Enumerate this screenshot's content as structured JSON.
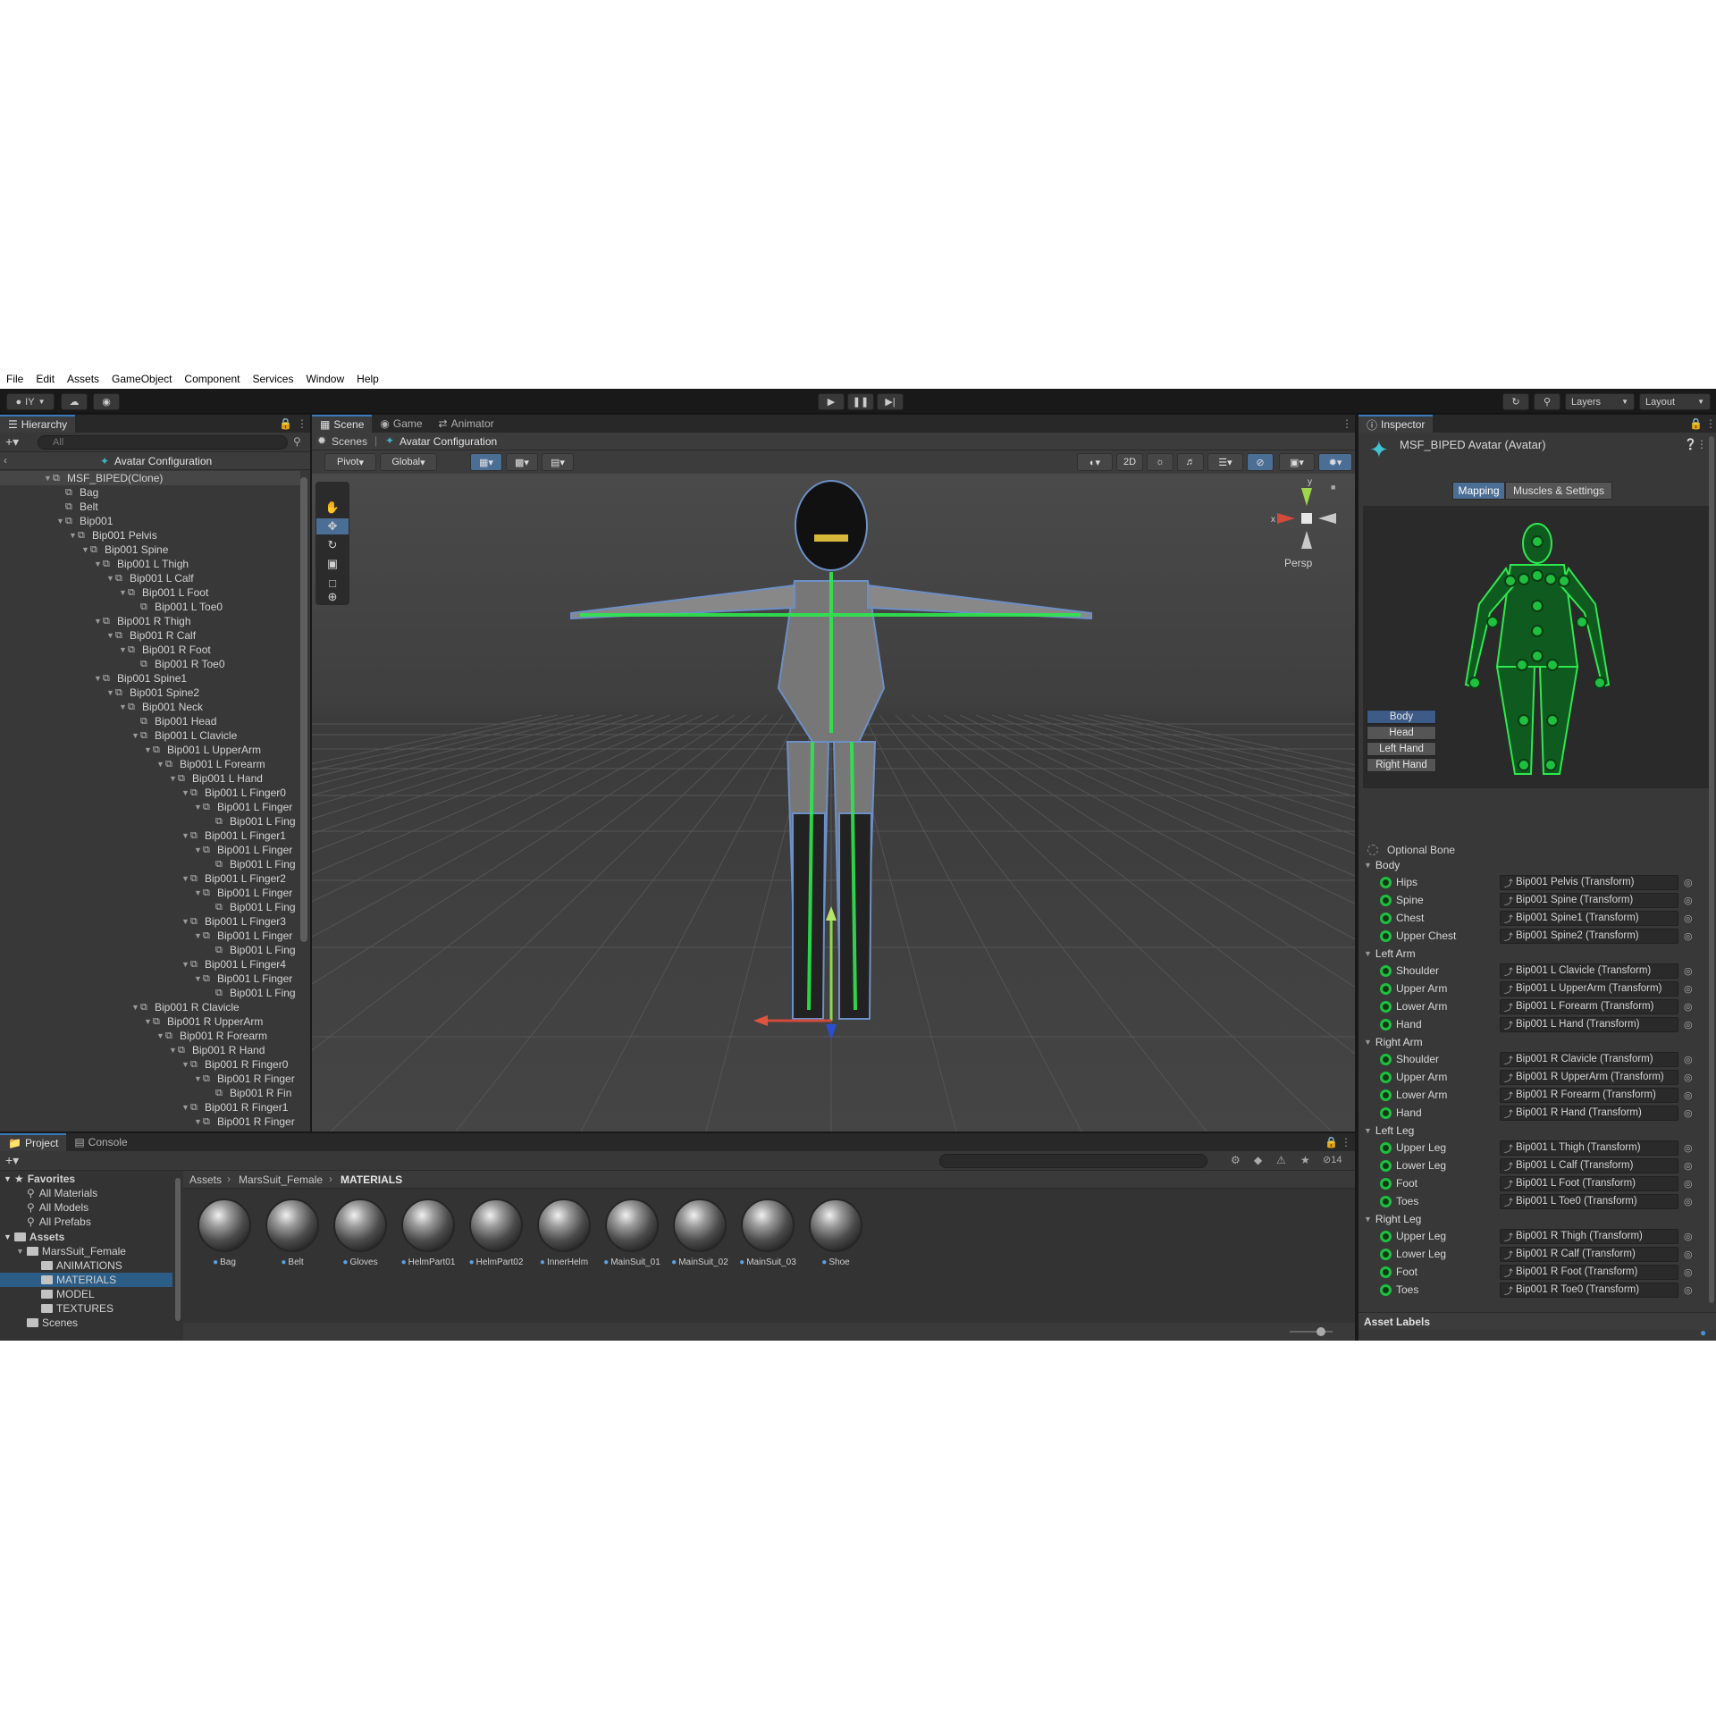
{
  "menu": [
    "File",
    "Edit",
    "Assets",
    "GameObject",
    "Component",
    "Services",
    "Window",
    "Help"
  ],
  "toolbar": {
    "account": "IY",
    "layers": "Layers",
    "layout": "Layout"
  },
  "hierarchy": {
    "tab": "Hierarchy",
    "search_placeholder": "All",
    "scene_title": "Avatar Configuration",
    "rows": [
      {
        "label": "MSF_BIPED(Clone)",
        "depth": 0,
        "expanded": true
      },
      {
        "label": "Bag",
        "depth": 1,
        "expanded": null
      },
      {
        "label": "Belt",
        "depth": 1,
        "expanded": null
      },
      {
        "label": "Bip001",
        "depth": 1,
        "expanded": true
      },
      {
        "label": "Bip001 Pelvis",
        "depth": 2,
        "expanded": true
      },
      {
        "label": "Bip001 Spine",
        "depth": 3,
        "expanded": true
      },
      {
        "label": "Bip001 L Thigh",
        "depth": 4,
        "expanded": true
      },
      {
        "label": "Bip001 L Calf",
        "depth": 5,
        "expanded": true
      },
      {
        "label": "Bip001 L Foot",
        "depth": 6,
        "expanded": true
      },
      {
        "label": "Bip001 L Toe0",
        "depth": 7,
        "expanded": null
      },
      {
        "label": "Bip001 R Thigh",
        "depth": 4,
        "expanded": true
      },
      {
        "label": "Bip001 R Calf",
        "depth": 5,
        "expanded": true
      },
      {
        "label": "Bip001 R Foot",
        "depth": 6,
        "expanded": true
      },
      {
        "label": "Bip001 R Toe0",
        "depth": 7,
        "expanded": null
      },
      {
        "label": "Bip001 Spine1",
        "depth": 4,
        "expanded": true
      },
      {
        "label": "Bip001 Spine2",
        "depth": 5,
        "expanded": true
      },
      {
        "label": "Bip001 Neck",
        "depth": 6,
        "expanded": true
      },
      {
        "label": "Bip001 Head",
        "depth": 7,
        "expanded": null
      },
      {
        "label": "Bip001 L Clavicle",
        "depth": 7,
        "expanded": true
      },
      {
        "label": "Bip001 L UpperArm",
        "depth": 8,
        "expanded": true
      },
      {
        "label": "Bip001 L Forearm",
        "depth": 9,
        "expanded": true
      },
      {
        "label": "Bip001 L Hand",
        "depth": 10,
        "expanded": true
      },
      {
        "label": "Bip001 L Finger0",
        "depth": 11,
        "expanded": true
      },
      {
        "label": "Bip001 L Finger",
        "depth": 12,
        "expanded": true
      },
      {
        "label": "Bip001 L Fing",
        "depth": 13,
        "expanded": null
      },
      {
        "label": "Bip001 L Finger1",
        "depth": 11,
        "expanded": true
      },
      {
        "label": "Bip001 L Finger",
        "depth": 12,
        "expanded": true
      },
      {
        "label": "Bip001 L Fing",
        "depth": 13,
        "expanded": null
      },
      {
        "label": "Bip001 L Finger2",
        "depth": 11,
        "expanded": true
      },
      {
        "label": "Bip001 L Finger",
        "depth": 12,
        "expanded": true
      },
      {
        "label": "Bip001 L Fing",
        "depth": 13,
        "expanded": null
      },
      {
        "label": "Bip001 L Finger3",
        "depth": 11,
        "expanded": true
      },
      {
        "label": "Bip001 L Finger",
        "depth": 12,
        "expanded": true
      },
      {
        "label": "Bip001 L Fing",
        "depth": 13,
        "expanded": null
      },
      {
        "label": "Bip001 L Finger4",
        "depth": 11,
        "expanded": true
      },
      {
        "label": "Bip001 L Finger",
        "depth": 12,
        "expanded": true
      },
      {
        "label": "Bip001 L Fing",
        "depth": 13,
        "expanded": null
      },
      {
        "label": "Bip001 R Clavicle",
        "depth": 7,
        "expanded": true
      },
      {
        "label": "Bip001 R UpperArm",
        "depth": 8,
        "expanded": true
      },
      {
        "label": "Bip001 R Forearm",
        "depth": 9,
        "expanded": true
      },
      {
        "label": "Bip001 R Hand",
        "depth": 10,
        "expanded": true
      },
      {
        "label": "Bip001 R Finger0",
        "depth": 11,
        "expanded": true
      },
      {
        "label": "Bip001 R Finger",
        "depth": 12,
        "expanded": true
      },
      {
        "label": "Bip001 R Fin",
        "depth": 13,
        "expanded": null
      },
      {
        "label": "Bip001 R Finger1",
        "depth": 11,
        "expanded": true
      },
      {
        "label": "Bip001 R Finger",
        "depth": 12,
        "expanded": true
      }
    ]
  },
  "sceneview": {
    "tabs": [
      "Scene",
      "Game",
      "Animator"
    ],
    "breadcrumb_root": "Scenes",
    "breadcrumb_current": "Avatar Configuration",
    "pivot": "Pivot",
    "global": "Global",
    "mode_2d": "2D",
    "persp": "Persp",
    "gizmo_x": "x",
    "gizmo_y": "y"
  },
  "inspector": {
    "tab": "Inspector",
    "title": "MSF_BIPED Avatar (Avatar)",
    "tab_mapping": "Mapping",
    "tab_muscles": "Muscles & Settings",
    "body_buttons": [
      "Body",
      "Head",
      "Left Hand",
      "Right Hand"
    ],
    "optional_bone": "Optional Bone",
    "groups": [
      {
        "name": "Body",
        "bones": [
          [
            "Hips",
            "Bip001 Pelvis (Transform)"
          ],
          [
            "Spine",
            "Bip001 Spine (Transform)"
          ],
          [
            "Chest",
            "Bip001 Spine1 (Transform)"
          ],
          [
            "Upper Chest",
            "Bip001 Spine2 (Transform)"
          ]
        ]
      },
      {
        "name": "Left Arm",
        "bones": [
          [
            "Shoulder",
            "Bip001 L Clavicle (Transform)"
          ],
          [
            "Upper Arm",
            "Bip001 L UpperArm (Transform)"
          ],
          [
            "Lower Arm",
            "Bip001 L Forearm (Transform)"
          ],
          [
            "Hand",
            "Bip001 L Hand (Transform)"
          ]
        ]
      },
      {
        "name": "Right Arm",
        "bones": [
          [
            "Shoulder",
            "Bip001 R Clavicle (Transform)"
          ],
          [
            "Upper Arm",
            "Bip001 R UpperArm (Transform)"
          ],
          [
            "Lower Arm",
            "Bip001 R Forearm (Transform)"
          ],
          [
            "Hand",
            "Bip001 R Hand (Transform)"
          ]
        ]
      },
      {
        "name": "Left Leg",
        "bones": [
          [
            "Upper Leg",
            "Bip001 L Thigh (Transform)"
          ],
          [
            "Lower Leg",
            "Bip001 L Calf (Transform)"
          ],
          [
            "Foot",
            "Bip001 L Foot (Transform)"
          ],
          [
            "Toes",
            "Bip001 L Toe0 (Transform)"
          ]
        ]
      },
      {
        "name": "Right Leg",
        "bones": [
          [
            "Upper Leg",
            "Bip001 R Thigh (Transform)"
          ],
          [
            "Lower Leg",
            "Bip001 R Calf (Transform)"
          ],
          [
            "Foot",
            "Bip001 R Foot (Transform)"
          ],
          [
            "Toes",
            "Bip001 R Toe0 (Transform)"
          ]
        ]
      }
    ],
    "asset_labels": "Asset Labels"
  },
  "project": {
    "tabs": [
      "Project",
      "Console"
    ],
    "hidden_count": "14",
    "favorites": "Favorites",
    "favorite_items": [
      "All Materials",
      "All Models",
      "All Prefabs"
    ],
    "assets": "Assets",
    "tree": [
      {
        "label": "MarsSuit_Female",
        "depth": 1
      },
      {
        "label": "ANIMATIONS",
        "depth": 2
      },
      {
        "label": "MATERIALS",
        "depth": 2,
        "selected": true
      },
      {
        "label": "MODEL",
        "depth": 2
      },
      {
        "label": "TEXTURES",
        "depth": 2
      },
      {
        "label": "Scenes",
        "depth": 1
      }
    ],
    "breadcrumb": [
      "Assets",
      "MarsSuit_Female",
      "MATERIALS"
    ],
    "materials": [
      "Bag",
      "Belt",
      "Gloves",
      "HelmPart01",
      "HelmPart02",
      "InnerHelm",
      "MainSuit_01",
      "MainSuit_02",
      "MainSuit_03",
      "Shoe"
    ]
  },
  "colors": {
    "accent": "#2c5d87",
    "bone_green": "#1fbf3f",
    "selection": "#2c5d87"
  }
}
